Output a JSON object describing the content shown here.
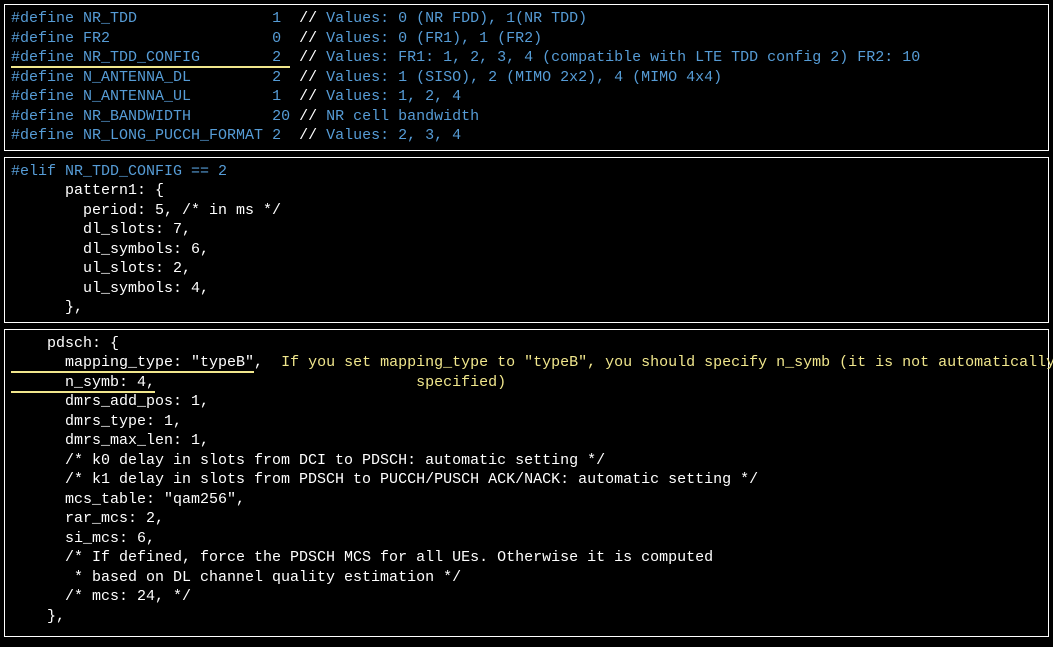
{
  "block1": {
    "lines": [
      {
        "define": "#define",
        "name": "NR_TDD               ",
        "val": "1 ",
        "slash": "//",
        "comment": " Values: 0 (NR FDD), 1(NR TDD)",
        "underline": false
      },
      {
        "define": "#define",
        "name": "FR2                  ",
        "val": "0 ",
        "slash": "//",
        "comment": " Values: 0 (FR1), 1 (FR2)",
        "underline": false
      },
      {
        "define": "#define",
        "name": "NR_TDD_CONFIG        ",
        "val": "2 ",
        "slash": "//",
        "comment": " Values: FR1: 1, 2, 3, 4 (compatible with LTE TDD config 2) FR2: 10",
        "underline": true
      },
      {
        "define": "#define",
        "name": "N_ANTENNA_DL         ",
        "val": "2 ",
        "slash": "//",
        "comment": " Values: 1 (SISO), 2 (MIMO 2x2), 4 (MIMO 4x4)",
        "underline": false
      },
      {
        "define": "#define",
        "name": "N_ANTENNA_UL         ",
        "val": "1 ",
        "slash": "//",
        "comment": " Values: 1, 2, 4",
        "underline": false
      },
      {
        "define": "#define",
        "name": "NR_BANDWIDTH         ",
        "val": "20",
        "slash": "//",
        "comment": " NR cell bandwidth",
        "underline": false
      },
      {
        "define": "#define",
        "name": "NR_LONG_PUCCH_FORMAT ",
        "val": "2 ",
        "slash": "//",
        "comment": " Values: 2, 3, 4",
        "underline": false
      }
    ]
  },
  "block2": {
    "elif": "#elif",
    "cond": "NR_TDD_CONFIG == 2",
    "pattern1": "      pattern1: {",
    "period": "        period: 5,",
    "period_comment": " /* in ms */",
    "dl_slots": "        dl_slots: 7,",
    "dl_symbols": "        dl_symbols: 6,",
    "ul_slots": "        ul_slots: 2,",
    "ul_symbols": "        ul_symbols: 4,",
    "close": "      },"
  },
  "block3": {
    "pdsch_open": "    pdsch: {",
    "mapping_type_label": "      mapping_type: ",
    "mapping_type_val": "\"typeB\"",
    "comma1": ",  ",
    "annotation1": "If you set mapping_type to \"typeB\", you should specify n_symb (it is not automatically",
    "n_symb": "      n_symb: 4,",
    "annotation2": "                             specified)",
    "dmrs_add_pos": "      dmrs_add_pos: 1,",
    "dmrs_type": "      dmrs_type: 1,",
    "dmrs_max_len": "      dmrs_max_len: 1,",
    "k0_comment": "      /* k0 delay in slots from DCI to PDSCH: automatic setting */",
    "k1_comment": "      /* k1 delay in slots from PDSCH to PUCCH/PUSCH ACK/NACK: automatic setting */",
    "mcs_table_label": "      mcs_table: ",
    "mcs_table_val": "\"qam256\"",
    "comma2": ",",
    "rar_mcs": "      rar_mcs: 2,",
    "si_mcs": "      si_mcs: 6,",
    "if_defined_comment1": "      /* If defined, force the PDSCH MCS for all UEs. Otherwise it is computed",
    "if_defined_comment2": "       * based on DL channel quality estimation */",
    "mcs_comment": "      /* mcs: 24, */",
    "close": "    },"
  }
}
